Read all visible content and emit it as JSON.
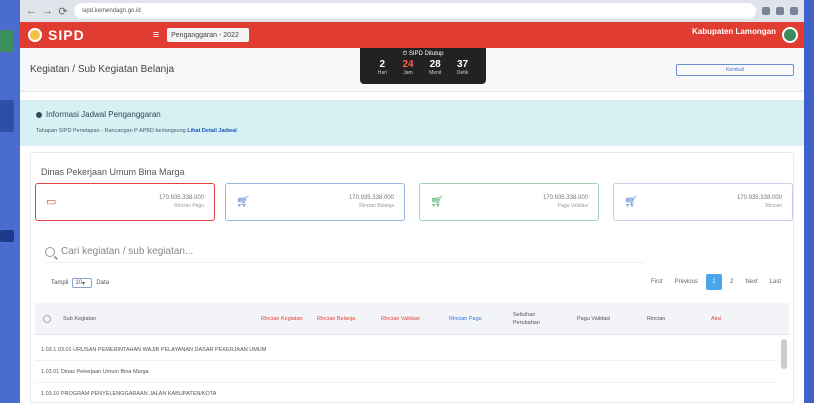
{
  "browser": {
    "address": "sipd.kemendagri.go.id"
  },
  "header": {
    "logo": "SIPD",
    "menu_icon": "menu-icon",
    "year_select": "Penganggaran - 2022",
    "region_name": "Kabupaten Lamongan"
  },
  "page": {
    "title": "Kegiatan / Sub Kegiatan Belanja",
    "action_button": "Kembali"
  },
  "timer": {
    "label": "SIPD Ditutup",
    "items": [
      {
        "value": "2",
        "unit": "Hari"
      },
      {
        "value": "24",
        "unit": "Jam"
      },
      {
        "value": "28",
        "unit": "Menit"
      },
      {
        "value": "37",
        "unit": "Detik"
      }
    ]
  },
  "info": {
    "heading": "Informasi Jadwal Penganggaran",
    "text": "Tahapan SIPD Penetapan - Rancangan P APBD berlangsung",
    "link": "Lihat Detail Jadwal"
  },
  "org_name": "Dinas Pekerjaan Umum Bina Marga",
  "stats": [
    {
      "icon": "folder-icon",
      "value": "170.935.338.000",
      "label": "Rincian Pagu",
      "color": "#e0443a"
    },
    {
      "icon": "cart-icon",
      "value": "170.935.338.000",
      "label": "Rincian Belanja",
      "color": "#5a86d6"
    },
    {
      "icon": "cart-icon",
      "value": "170.935.338.000",
      "label": "Pagu Validasi",
      "color": "#4caf6a"
    },
    {
      "icon": "cart-icon",
      "value": "170.935.338.000",
      "label": "Rincian",
      "color": "#5a86d6"
    }
  ],
  "search": {
    "placeholder": "Cari kegiatan / sub kegiatan..."
  },
  "table": {
    "show_label": "Tampil",
    "show_value": "10",
    "show_suffix": "Data",
    "pager": [
      "First",
      "Previous",
      "1",
      "2",
      "Next",
      "Last"
    ],
    "headers": [
      "Sub Kegiatan",
      "Rincian Kegiatan",
      "Rincian Belanja",
      "Rincian Validasi",
      "Rincian Pagu",
      "Selisihan Perubahan",
      "Pagu Validasi",
      "Rincian",
      "Aksi"
    ],
    "rows": [
      "1.03.1.03.01 URUSAN PEMERINTAHAN WAJIB PELAYANAN DASAR PEKERJAAN UMUM",
      "1.03.01 Dinas Pekerjaan Umum Bina Marga",
      "1.03.10 PROGRAM PENYELENGGARAAN JALAN KABUPATEN/KOTA"
    ]
  }
}
